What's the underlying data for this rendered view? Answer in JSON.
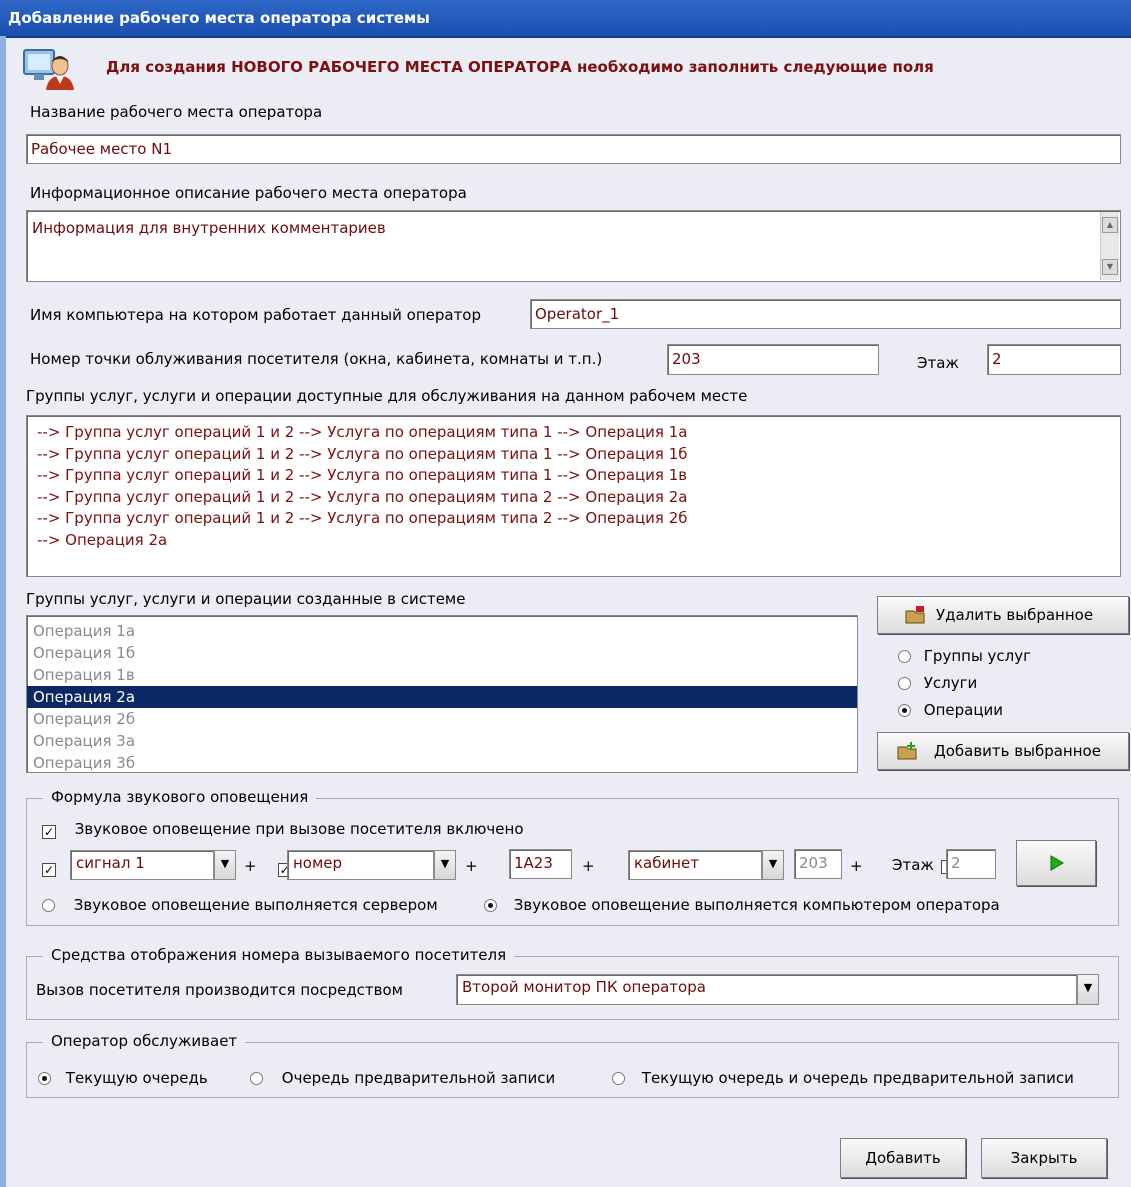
{
  "window": {
    "title": "Добавление рабочего места оператора системы"
  },
  "header": {
    "note": "Для создания НОВОГО РАБОЧЕГО МЕСТА ОПЕРАТОРА необходимо заполнить следующие поля"
  },
  "name_field": {
    "label": "Название рабочего места оператора",
    "value": "Рабочее место N1"
  },
  "description_field": {
    "label": "Информационное описание рабочего места оператора",
    "value": "Информация для внутренних комментариев"
  },
  "computer_field": {
    "label": "Имя компьютера на котором работает данный оператор",
    "value": "Operator_1"
  },
  "service_point": {
    "label": "Номер точки облуживания посетителя (окна, кабинета, комнаты и т.п.)",
    "value": "203",
    "floor_label": "Этаж",
    "floor_value": "2"
  },
  "available_list": {
    "label": "Группы услуг, услуги и операции доступные для обслуживания на данном рабочем месте",
    "items": [
      "--> Группа услуг операций 1 и 2 --> Услуга по операциям типа 1 --> Операция 1а",
      "--> Группа услуг операций 1 и 2 --> Услуга по операциям типа 1 --> Операция 1б",
      "--> Группа услуг операций 1 и 2 --> Услуга по операциям типа 1 --> Операция 1в",
      "--> Группа услуг операций 1 и 2 --> Услуга по операциям типа 2 --> Операция 2а",
      "--> Группа услуг операций 1 и 2 --> Услуга по операциям типа 2 --> Операция 2б",
      "--> Операция 2а"
    ]
  },
  "system_list": {
    "label": "Группы услуг, услуги и операции созданные в системе",
    "items": [
      "Операция 1а",
      "Операция 1б",
      "Операция 1в",
      "Операция 2а",
      "Операция 2б",
      "Операция 3а",
      "Операция 3б"
    ],
    "selected_index": 3
  },
  "side_controls": {
    "delete_button": "Удалить выбранное",
    "add_button": "Добавить выбранное",
    "radios": [
      "Группы услуг",
      "Услуги",
      "Операции"
    ],
    "selected_radio": 2
  },
  "sound": {
    "group_title": "Формула звукового оповещения",
    "enabled_label": "Звуковое оповещение при вызове посетителя включено",
    "combo1": "сигнал 1",
    "plus": "+",
    "combo2": "номер",
    "text3": "1А23",
    "combo4": "кабинет",
    "text5": "203",
    "floor_label": "Этаж",
    "floor_value": "2",
    "radio_server": "Звуковое оповещение выполняется сервером",
    "radio_operator": "Звуковое оповещение выполняется компьютером оператора",
    "selected_radio": "operator"
  },
  "display": {
    "group_title": "Средства отображения  номера  вызываемого посетителя",
    "label": "Вызов посетителя производится посредством",
    "value": "Второй монитор ПК оператора"
  },
  "serves": {
    "group_title": "Оператор обслуживает",
    "options": [
      "Текущую очередь",
      "Очередь предварительной записи",
      "Текущую очередь и очередь предварительной записи"
    ],
    "selected": 0
  },
  "footer": {
    "add_button": "Добавить",
    "close_button": "Закрыть"
  },
  "colors": {
    "title_bar": "#1a4fae",
    "selection": "#0a2866",
    "entry_text": "#6e0b0b",
    "header_note": "#7a1010"
  }
}
